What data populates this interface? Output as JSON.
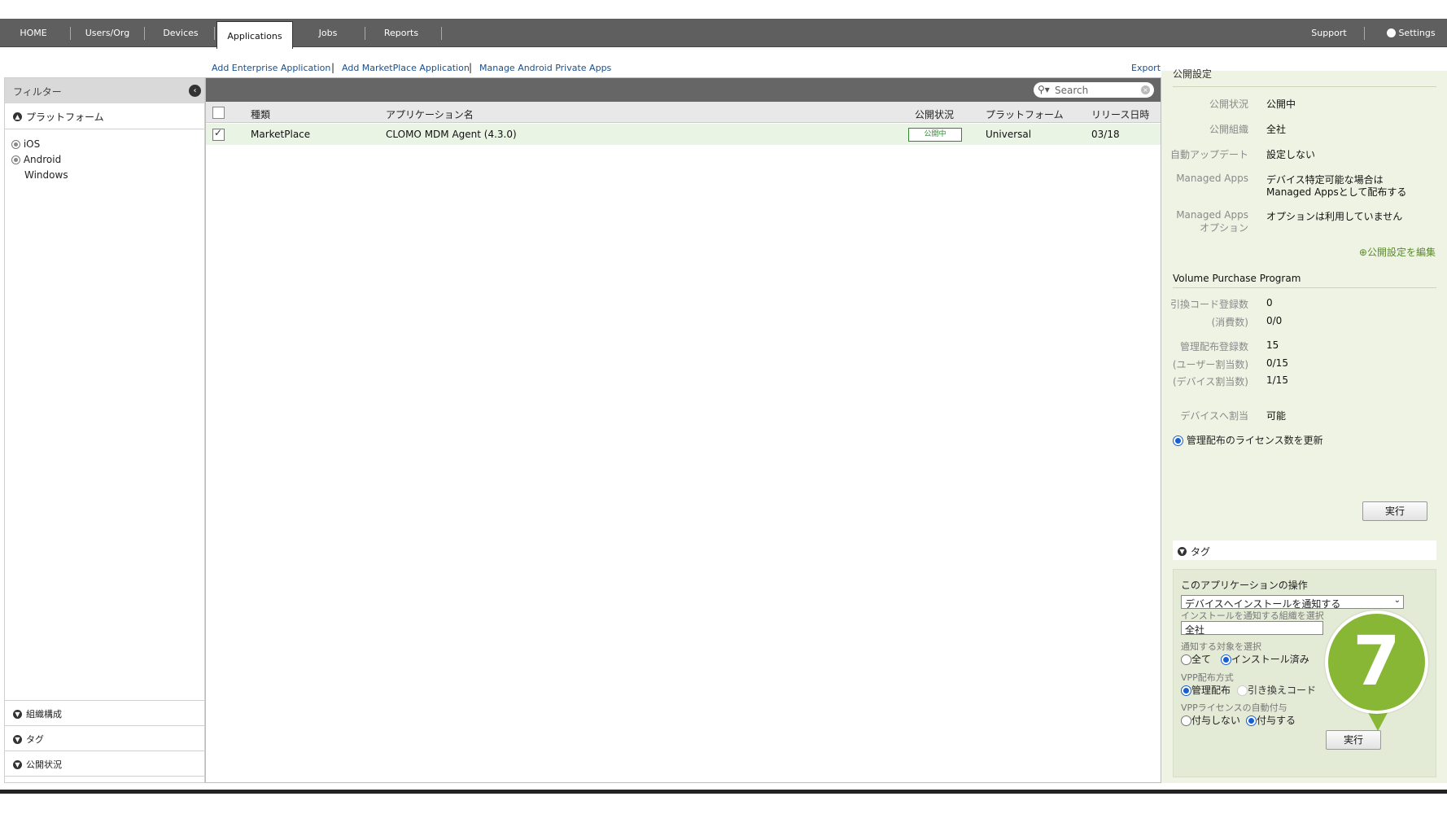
{
  "nav": {
    "items": [
      "HOME",
      "Users/Org",
      "Devices",
      "Applications",
      "Jobs",
      "Reports"
    ],
    "active": "Applications",
    "support": "Support",
    "settings": "Settings"
  },
  "links": {
    "add_enterprise": "Add Enterprise Application",
    "add_marketplace": "Add MarketPlace Application",
    "manage_android": "Manage Android Private Apps",
    "export": "Export"
  },
  "sidebar": {
    "filter_title": "フィルター",
    "platform_section": "プラットフォーム",
    "platforms": [
      "iOS",
      "Android",
      "Windows"
    ],
    "bottom_sections": [
      "組織構成",
      "タグ",
      "公開状況"
    ]
  },
  "search": {
    "placeholder": "Search"
  },
  "table": {
    "headers": [
      "種類",
      "アプリケーション名",
      "公開状況",
      "プラットフォーム",
      "リリース日時"
    ],
    "rows": [
      {
        "checked": true,
        "type": "MarketPlace",
        "name": "CLOMO MDM Agent (4.3.0)",
        "status": "公開中",
        "platform": "Universal",
        "release": "03/18"
      }
    ]
  },
  "right": {
    "publish_section_title": "公開設定",
    "publish": [
      {
        "label": "公開状況",
        "value": "公開中"
      },
      {
        "label": "公開組織",
        "value": "全社"
      },
      {
        "label": "自動アップデート",
        "value": "設定しない"
      },
      {
        "label": "Managed Apps",
        "value": "デバイス特定可能な場合は",
        "value2": "Managed Appsとして配布する"
      },
      {
        "label": "Managed Apps",
        "label2": "オプション",
        "value": "オプションは利用していません"
      }
    ],
    "edit_publish_link": "公開設定を編集",
    "vpp_title": "Volume Purchase Program",
    "vpp": [
      {
        "label": "引換コード登録数",
        "value": "0"
      },
      {
        "label": "(消費数)",
        "value": "0/0"
      },
      {
        "label": "管理配布登録数",
        "value": "15"
      },
      {
        "label": "(ユーザー割当数)",
        "value": "0/15"
      },
      {
        "label": "(デバイス割当数)",
        "value": "1/15"
      },
      {
        "label": "デバイスへ割当",
        "value": "可能"
      }
    ],
    "update_license_radio": "管理配布のライセンス数を更新",
    "run_button_1": "実行",
    "tag_section": "タグ",
    "ops": {
      "title": "このアプリケーションの操作",
      "action_select": "デバイスへインストールを通知する",
      "org_label": "インストールを通知する組織を選択",
      "org_value": "全社",
      "target_label": "通知する対象を選択",
      "target_all": "全て",
      "target_installed": "インストール済み",
      "vpp_method_label": "VPP配布方式",
      "vpp_managed": "管理配布",
      "vpp_redeem": "引き換えコード",
      "auto_license_label": "VPPライセンスの自動付与",
      "auto_no": "付与しない",
      "auto_yes": "付与する",
      "run_button_2": "実行"
    }
  },
  "marker": {
    "number": "7",
    "color": "#87b735"
  }
}
